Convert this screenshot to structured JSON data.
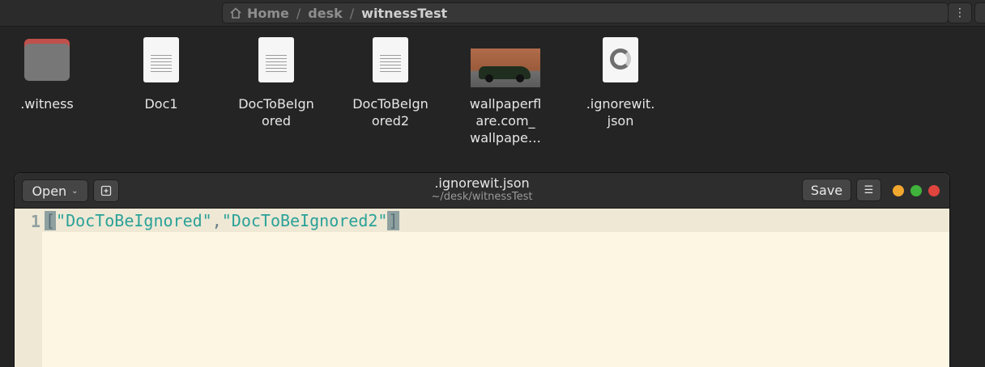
{
  "file_manager": {
    "path": [
      "Home",
      "desk",
      "witnessTest"
    ],
    "files": [
      {
        "name_line1": ".witness",
        "name_line2": "",
        "name_line3": "",
        "icon": "folder-icon"
      },
      {
        "name_line1": "Doc1",
        "name_line2": "",
        "name_line3": "",
        "icon": "document-icon"
      },
      {
        "name_line1": "DocToBeIgn",
        "name_line2": "ored",
        "name_line3": "",
        "icon": "document-icon"
      },
      {
        "name_line1": "DocToBeIgn",
        "name_line2": "ored2",
        "name_line3": "",
        "icon": "document-icon"
      },
      {
        "name_line1": "wallpaperfl",
        "name_line2": "are.com_",
        "name_line3": "wallpape…",
        "icon": "image-thumbnail"
      },
      {
        "name_line1": ".ignorewit.",
        "name_line2": "json",
        "name_line3": "",
        "icon": "json-file-icon"
      }
    ],
    "menu_icon": "kebab-menu-icon"
  },
  "editor": {
    "open_label": "Open",
    "title": ".ignorewit.json",
    "subtitle": "~/desk/witnessTest",
    "save_label": "Save",
    "line_number": "1",
    "code": {
      "open_bracket": "[",
      "str1": "\"DocToBeIgnored\"",
      "comma": ",",
      "str2": "\"DocToBeIgnored2\"",
      "close_bracket": "]"
    },
    "colors": {
      "background": "#fdf6e3",
      "current_line": "#eee8d5",
      "string": "#2aa198",
      "minimize": "#f2a72f",
      "maximize": "#3fb33b",
      "close": "#e0443e"
    }
  }
}
